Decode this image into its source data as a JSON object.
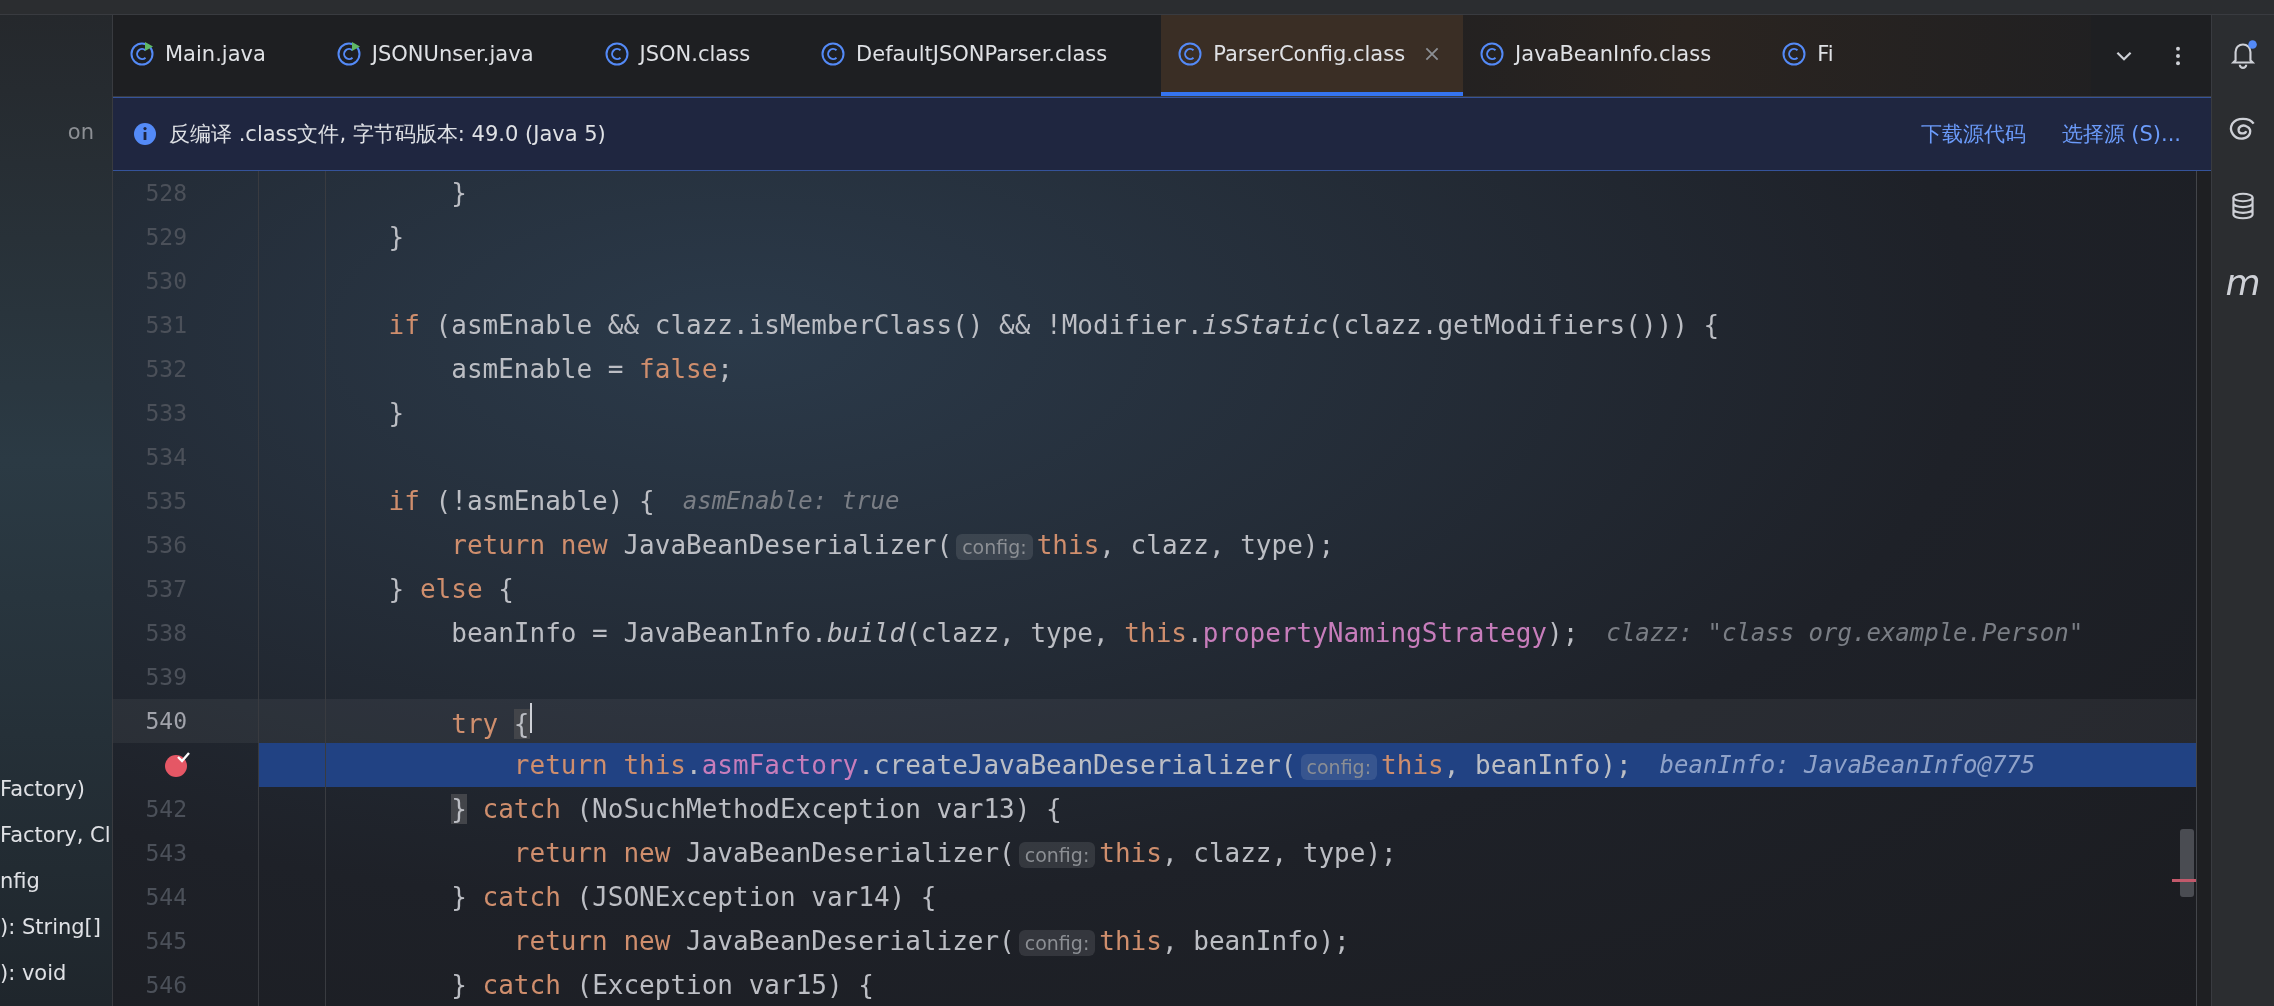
{
  "left_panel": {
    "items": [
      {
        "label": "on"
      },
      {
        "label": "Factory)"
      },
      {
        "label": "Factory, Cl"
      },
      {
        "label": "nfig"
      },
      {
        "label": "): String[]"
      },
      {
        "label": "): void"
      }
    ]
  },
  "tabs": [
    {
      "label": "Main.java",
      "kind": "java",
      "selected": false,
      "closable": false
    },
    {
      "label": "JSONUnser.java",
      "kind": "java",
      "selected": false,
      "closable": false
    },
    {
      "label": "JSON.class",
      "kind": "class",
      "selected": false,
      "closable": false
    },
    {
      "label": "DefaultJSONParser.class",
      "kind": "class",
      "selected": false,
      "closable": false
    },
    {
      "label": "ParserConfig.class",
      "kind": "class",
      "selected": true,
      "closable": true
    },
    {
      "label": "JavaBeanInfo.class",
      "kind": "class",
      "selected": false,
      "closable": false
    },
    {
      "label": "Fi",
      "kind": "class",
      "selected": false,
      "closable": false
    }
  ],
  "info_bar": {
    "message": "反编译 .class文件, 字节码版本: 49.0 (Java 5)",
    "links": [
      "下载源代码",
      "选择源 (S)..."
    ]
  },
  "editor": {
    "lines": [
      {
        "number": "528",
        "current": false,
        "execution": false,
        "breakpoint": false,
        "tokens": [
          {
            "kind": "code",
            "text": "        }"
          }
        ]
      },
      {
        "number": "529",
        "current": false,
        "execution": false,
        "breakpoint": false,
        "tokens": [
          {
            "kind": "code",
            "text": "    }"
          }
        ]
      },
      {
        "number": "530",
        "current": false,
        "execution": false,
        "breakpoint": false
      },
      {
        "number": "531",
        "current": false,
        "execution": false,
        "breakpoint": false,
        "tokens": [
          {
            "kind": "keyword",
            "text": "    if"
          },
          {
            "kind": "code",
            "text": " (asmEnable && clazz.isMemberClass() && !Modifier."
          },
          {
            "kind": "italic",
            "text": "isStatic"
          },
          {
            "kind": "code",
            "text": "(clazz.getModifiers())) {"
          }
        ]
      },
      {
        "number": "532",
        "current": false,
        "execution": false,
        "breakpoint": false,
        "tokens": [
          {
            "kind": "code",
            "text": "        asmEnable = "
          },
          {
            "kind": "keyword",
            "text": "false"
          },
          {
            "kind": "code",
            "text": ";"
          }
        ]
      },
      {
        "number": "533",
        "current": false,
        "execution": false,
        "breakpoint": false,
        "tokens": [
          {
            "kind": "code",
            "text": "    }"
          }
        ]
      },
      {
        "number": "534",
        "current": false,
        "execution": false,
        "breakpoint": false
      },
      {
        "number": "535",
        "current": false,
        "execution": false,
        "breakpoint": false,
        "tokens": [
          {
            "kind": "keyword",
            "text": "    if"
          },
          {
            "kind": "code",
            "text": " (!asmEnable) {"
          }
        ],
        "value": "asmEnable: true"
      },
      {
        "number": "536",
        "current": false,
        "execution": false,
        "breakpoint": false,
        "tokens": [
          {
            "kind": "keyword",
            "text": "        return new"
          },
          {
            "kind": "code",
            "text": " JavaBeanDeserializer("
          },
          {
            "kind": "hint",
            "text": "config:"
          },
          {
            "kind": "keyword",
            "text": "this"
          },
          {
            "kind": "code",
            "text": ", clazz, type);"
          }
        ]
      },
      {
        "number": "537",
        "current": false,
        "execution": false,
        "breakpoint": false,
        "tokens": [
          {
            "kind": "code",
            "text": "    } "
          },
          {
            "kind": "keyword",
            "text": "else"
          },
          {
            "kind": "code",
            "text": " {"
          }
        ]
      },
      {
        "number": "538",
        "current": false,
        "execution": false,
        "breakpoint": false,
        "tokens": [
          {
            "kind": "code",
            "text": "        beanInfo = JavaBeanInfo."
          },
          {
            "kind": "italic",
            "text": "build"
          },
          {
            "kind": "code",
            "text": "(clazz, type, "
          },
          {
            "kind": "keyword",
            "text": "this"
          },
          {
            "kind": "field",
            "text": ".propertyNamingStrategy"
          },
          {
            "kind": "code",
            "text": ");"
          }
        ],
        "value": "clazz: \"class org.example.Person\""
      },
      {
        "number": "539",
        "current": false,
        "execution": false,
        "breakpoint": false
      },
      {
        "number": "540",
        "current": true,
        "execution": false,
        "breakpoint": false,
        "tokens": [
          {
            "kind": "keyword",
            "text": "        try "
          },
          {
            "kind": "match",
            "text": "{"
          }
        ]
      },
      {
        "current": false,
        "execution": true,
        "breakpoint": true,
        "tokens": [
          {
            "kind": "keyword",
            "text": "            return this"
          },
          {
            "kind": "field",
            "text": ".asmFactory"
          },
          {
            "kind": "code",
            "text": ".createJavaBeanDeserializer("
          },
          {
            "kind": "hint",
            "text": "config:"
          },
          {
            "kind": "keyword",
            "text": "this"
          },
          {
            "kind": "code",
            "text": ", beanInfo);"
          }
        ],
        "value": "beanInfo: JavaBeanInfo@775"
      },
      {
        "number": "542",
        "current": false,
        "execution": false,
        "breakpoint": false,
        "tokens": [
          {
            "kind": "match",
            "text": "        }"
          },
          {
            "kind": "keyword",
            "text": " catch"
          },
          {
            "kind": "code",
            "text": " (NoSuchMethodException var13) {"
          }
        ]
      },
      {
        "number": "543",
        "current": false,
        "execution": false,
        "breakpoint": false,
        "tokens": [
          {
            "kind": "keyword",
            "text": "            return new"
          },
          {
            "kind": "code",
            "text": " JavaBeanDeserializer("
          },
          {
            "kind": "hint",
            "text": "config:"
          },
          {
            "kind": "keyword",
            "text": "this"
          },
          {
            "kind": "code",
            "text": ", clazz, type);"
          }
        ]
      },
      {
        "number": "544",
        "current": false,
        "execution": false,
        "breakpoint": false,
        "tokens": [
          {
            "kind": "code",
            "text": "        } "
          },
          {
            "kind": "keyword",
            "text": "catch"
          },
          {
            "kind": "code",
            "text": " (JSONException var14) {"
          }
        ]
      },
      {
        "number": "545",
        "current": false,
        "execution": false,
        "breakpoint": false,
        "tokens": [
          {
            "kind": "keyword",
            "text": "            return new"
          },
          {
            "kind": "code",
            "text": " JavaBeanDeserializer("
          },
          {
            "kind": "hint",
            "text": "config:"
          },
          {
            "kind": "keyword",
            "text": "this"
          },
          {
            "kind": "code",
            "text": ", beanInfo);"
          }
        ]
      },
      {
        "number": "546",
        "current": false,
        "execution": false,
        "breakpoint": false,
        "tokens": [
          {
            "kind": "code",
            "text": "        } "
          },
          {
            "kind": "keyword",
            "text": "catch"
          },
          {
            "kind": "code",
            "text": " (Exception var15) {"
          }
        ]
      }
    ]
  },
  "right_sidebar": [
    {
      "kind": "bell",
      "badge": true
    },
    {
      "kind": "spiral",
      "badge": false
    },
    {
      "kind": "database",
      "badge": false
    },
    {
      "kind": "letter",
      "label": "m",
      "badge": false
    }
  ]
}
